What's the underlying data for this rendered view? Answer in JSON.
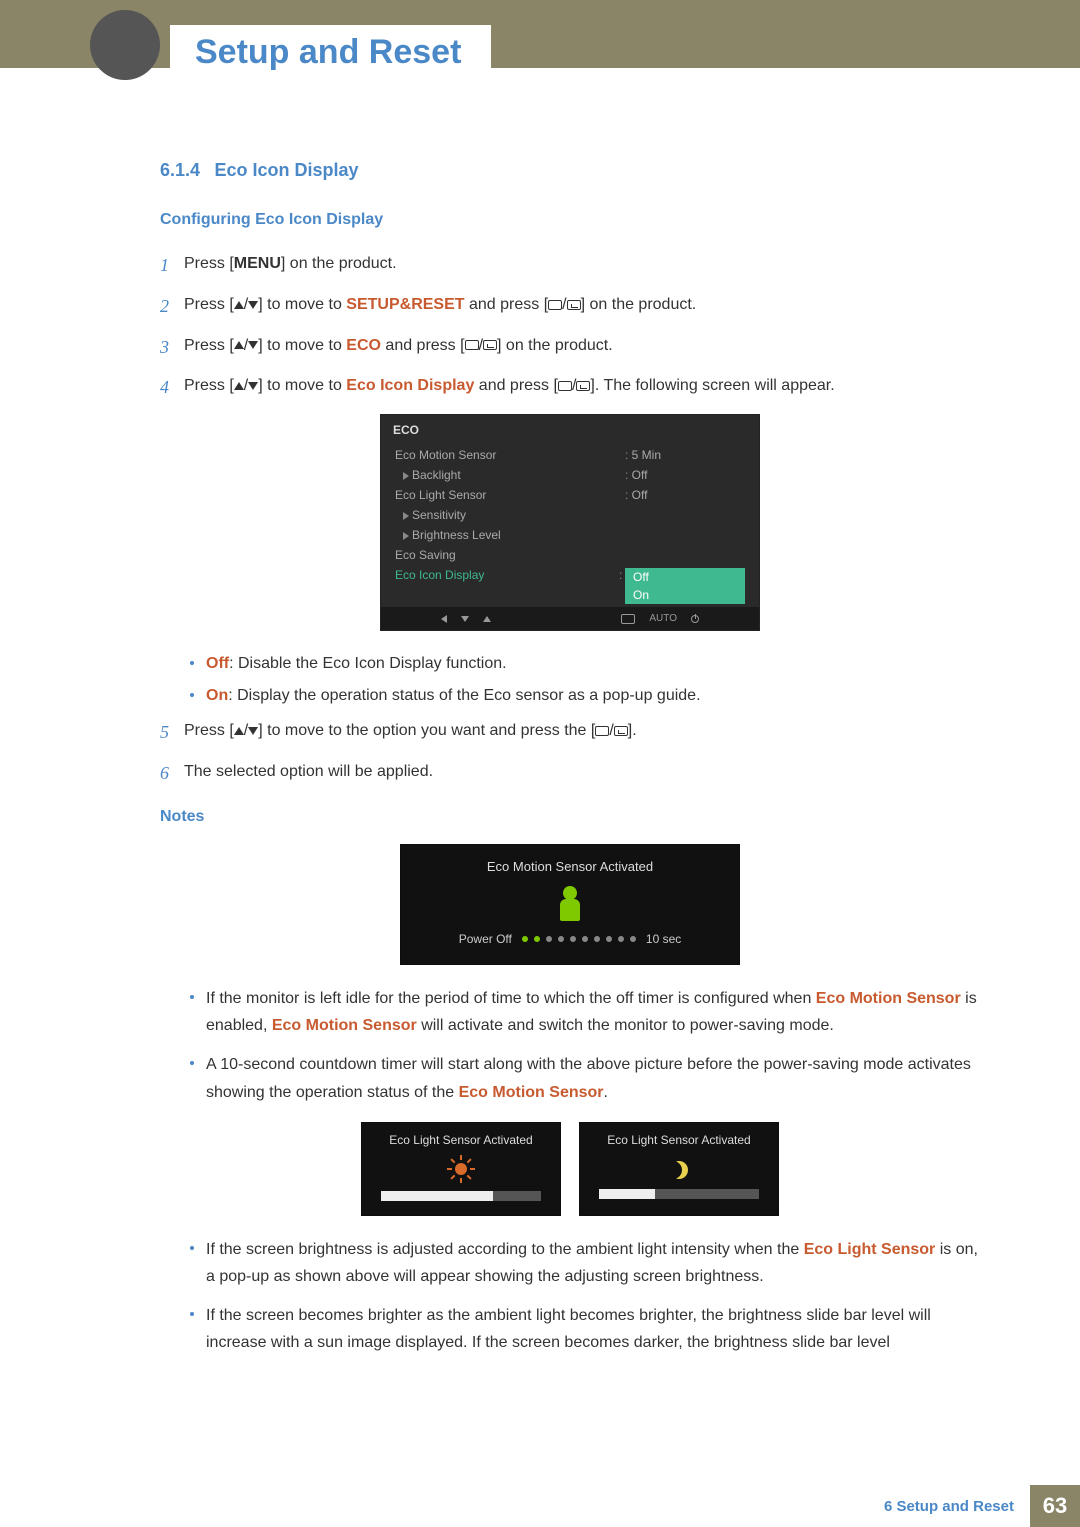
{
  "header": {
    "title": "Setup and Reset"
  },
  "section": {
    "number": "6.1.4",
    "title": "Eco Icon Display"
  },
  "subheading": "Configuring Eco Icon Display",
  "steps": {
    "s1": {
      "pre": "Press [",
      "kw": "MENU",
      "post": "] on the product."
    },
    "s2": {
      "pre": "Press [",
      "mid": "] to move to ",
      "kw": "SETUP&RESET",
      "post1": " and press [",
      "post2": "] on the product."
    },
    "s3": {
      "pre": "Press [",
      "mid": "] to move to ",
      "kw": "ECO",
      "post1": " and press [",
      "post2": "] on the product."
    },
    "s4": {
      "pre": "Press [",
      "mid": "] to move to ",
      "kw": "Eco Icon Display",
      "post1": " and press [",
      "post2": "]. The following screen will appear."
    },
    "s5": {
      "pre": "Press [",
      "mid": "] to move to the option you want and press the [",
      "post": "]."
    },
    "s6": {
      "text": "The selected option will be applied."
    }
  },
  "menu": {
    "title": "ECO",
    "items": {
      "ecoMotion": {
        "label": "Eco Motion Sensor",
        "value": "5 Min"
      },
      "backlight": {
        "label": "Backlight",
        "value": "Off"
      },
      "ecoLight": {
        "label": "Eco Light Sensor",
        "value": "Off"
      },
      "sensitivity": {
        "label": "Sensitivity"
      },
      "brightness": {
        "label": "Brightness Level"
      },
      "ecoSaving": {
        "label": "Eco Saving"
      },
      "ecoIcon": {
        "label": "Eco Icon Display",
        "opt1": "Off",
        "opt2": "On"
      }
    },
    "footer": {
      "auto": "AUTO"
    }
  },
  "options": {
    "off": {
      "kw": "Off",
      "text": ": Disable the Eco Icon Display function."
    },
    "on": {
      "kw": "On",
      "text": ": Display the operation status of the Eco sensor as a pop-up guide."
    }
  },
  "notes": {
    "title": "Notes",
    "motionPopup": {
      "title": "Eco Motion Sensor Activated",
      "labelLeft": "Power Off",
      "labelRight": "10 sec"
    },
    "b1": {
      "p1": "If the monitor is left idle for the period of time to which the off timer is configured when ",
      "kw1": "Eco Motion Sensor",
      "p2": " is enabled, ",
      "kw2": "Eco Motion Sensor",
      "p3": " will activate and switch the monitor to power-saving mode."
    },
    "b2": {
      "p1": "A 10-second countdown timer will start along with the above picture before the power-saving mode activates showing the operation status of the ",
      "kw1": "Eco Motion Sensor",
      "p2": "."
    },
    "lightPopup": {
      "title1": "Eco Light Sensor Activated",
      "title2": "Eco Light Sensor Activated"
    },
    "b3": {
      "p1": "If the screen brightness is adjusted according to the ambient light intensity when the ",
      "kw1": "Eco Light Sensor",
      "p2": " is on, a pop-up as shown above will appear showing the adjusting screen brightness."
    },
    "b4": {
      "p1": "If the screen becomes brighter as the ambient light becomes brighter, the brightness slide bar level will increase with a sun image displayed. If the screen becomes darker, the brightness slide bar level"
    }
  },
  "footer": {
    "chapter": "6 Setup and Reset",
    "page": "63"
  }
}
